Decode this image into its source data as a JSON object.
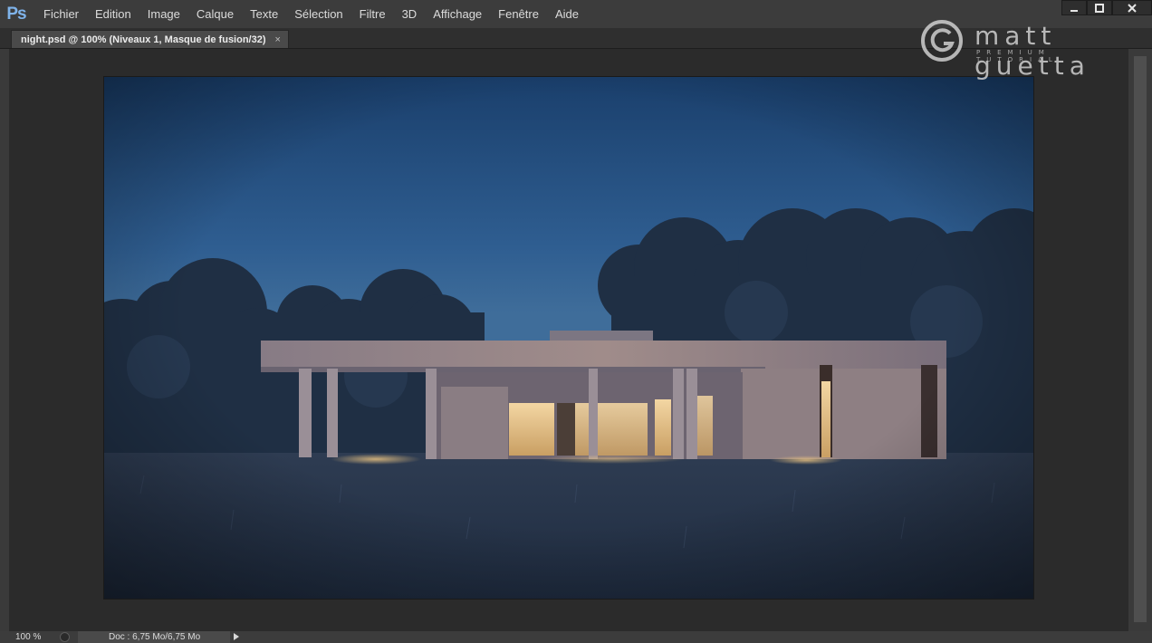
{
  "app": {
    "logo": "Ps"
  },
  "menu": {
    "items": [
      "Fichier",
      "Edition",
      "Image",
      "Calque",
      "Texte",
      "Sélection",
      "Filtre",
      "3D",
      "Affichage",
      "Fenêtre",
      "Aide"
    ]
  },
  "window_controls": {
    "minimize": "minimize-icon",
    "maximize": "maximize-icon",
    "close": "close-icon"
  },
  "document": {
    "tab_title": "night.psd @ 100% (Niveaux 1, Masque de fusion/32)",
    "tab_close": "×"
  },
  "watermark": {
    "name": "matt guetta",
    "subtitle": "PREMIUM TUTORIAL"
  },
  "status": {
    "zoom": "100 %",
    "doc_info": "Doc : 6,75 Mo/6,75 Mo"
  },
  "colors": {
    "menubar": "#3c3c3c",
    "workspace": "#2b2b2b",
    "sky_top": "#1d4677",
    "sky_horizon": "#3f6c99",
    "grass": "#2b3b54",
    "window_glow": "#e7c48d"
  }
}
